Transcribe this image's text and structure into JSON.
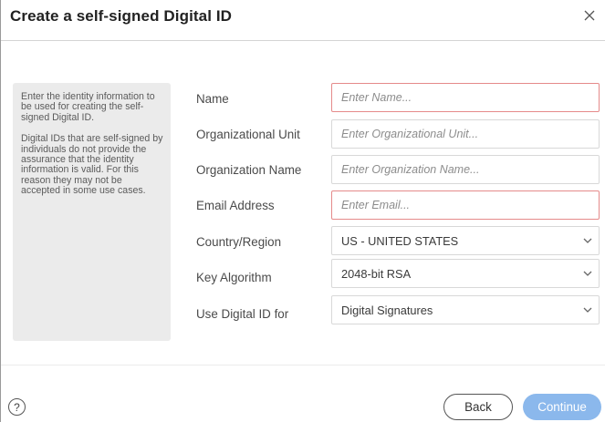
{
  "dialog": {
    "title": "Create a self-signed Digital ID"
  },
  "info": {
    "paragraph1": "Enter the identity information to be used for creating the self-signed Digital ID.",
    "paragraph2": "Digital IDs that are self-signed by individuals do not provide the assurance that the identity information is valid. For this reason they may not be accepted in some use cases."
  },
  "form": {
    "name": {
      "label": "Name",
      "placeholder": "Enter Name...",
      "value": ""
    },
    "org_unit": {
      "label": "Organizational Unit",
      "placeholder": "Enter Organizational Unit...",
      "value": ""
    },
    "org_name": {
      "label": "Organization Name",
      "placeholder": "Enter Organization Name...",
      "value": ""
    },
    "email": {
      "label": "Email Address",
      "placeholder": "Enter Email...",
      "value": ""
    },
    "country": {
      "label": "Country/Region",
      "selected": "US - UNITED STATES"
    },
    "key_algorithm": {
      "label": "Key Algorithm",
      "selected": "2048-bit RSA"
    },
    "use_for": {
      "label": "Use Digital ID for",
      "selected": "Digital Signatures"
    }
  },
  "footer": {
    "help_glyph": "?",
    "back_label": "Back",
    "continue_label": "Continue"
  },
  "icons": {
    "close": "close-icon",
    "chevron": "chevron-down-icon",
    "help": "help-icon"
  },
  "colors": {
    "required_border": "#e58a8a",
    "continue_bg": "#8bb8ec",
    "panel_bg": "#ebebeb"
  }
}
